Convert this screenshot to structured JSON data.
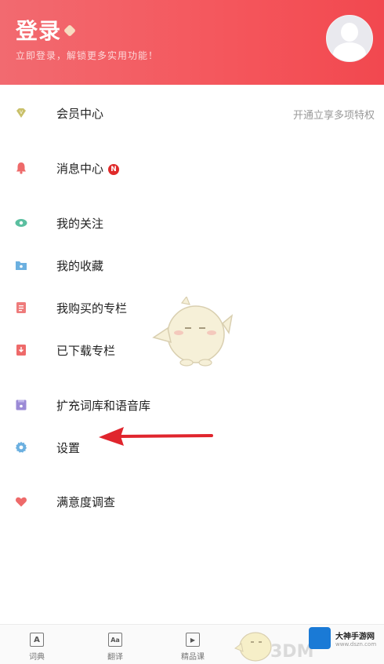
{
  "header": {
    "title": "登录",
    "subtitle": "立即登录，解锁更多实用功能！"
  },
  "menu": [
    {
      "name": "vip",
      "label": "会员中心",
      "extra": "开通立享多项特权",
      "icon": "diamond-icon",
      "color": "#c9c06a"
    },
    {
      "name": "messages",
      "label": "消息中心",
      "badge": "N",
      "icon": "bell-icon",
      "color": "#ee6a6a"
    },
    {
      "name": "following",
      "label": "我的关注",
      "icon": "eye-icon",
      "color": "#5bbfa0"
    },
    {
      "name": "favorites",
      "label": "我的收藏",
      "icon": "folder-star-icon",
      "color": "#6cb0e0"
    },
    {
      "name": "purchased",
      "label": "我购买的专栏",
      "icon": "document-icon",
      "color": "#ee7b7b"
    },
    {
      "name": "downloaded",
      "label": "已下载专栏",
      "icon": "download-icon",
      "color": "#ee6a6a"
    },
    {
      "name": "expand-library",
      "label": "扩充词库和语音库",
      "icon": "library-icon",
      "color": "#9b8ad6"
    },
    {
      "name": "settings",
      "label": "设置",
      "icon": "gear-icon",
      "color": "#6cb0e0"
    },
    {
      "name": "survey",
      "label": "满意度调查",
      "icon": "heart-icon",
      "color": "#ee6a6a"
    }
  ],
  "tabbar": [
    {
      "name": "dictionary",
      "label": "词典",
      "glyph": "A"
    },
    {
      "name": "translate",
      "label": "翻译",
      "glyph": "Aa"
    },
    {
      "name": "courses",
      "label": "精品课",
      "glyph": "▶"
    }
  ],
  "watermark": {
    "title": "大神手游网",
    "sub": "www.dszn.com",
    "brand": "3DM"
  }
}
